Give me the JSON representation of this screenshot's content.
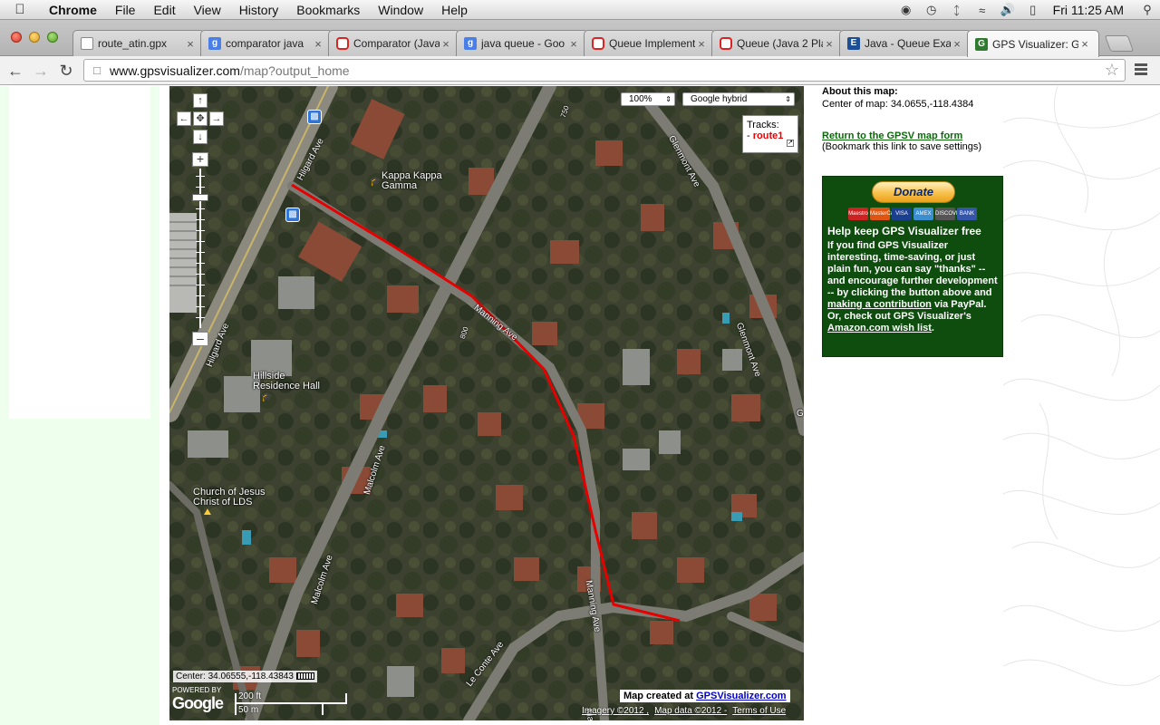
{
  "menubar": {
    "app_name": "Chrome",
    "items": [
      "File",
      "Edit",
      "View",
      "History",
      "Bookmarks",
      "Window",
      "Help"
    ],
    "clock": "Fri 11:25 AM",
    "status_icons": [
      "time-machine-icon",
      "history-clock-icon",
      "bluetooth-icon",
      "wifi-icon",
      "volume-icon",
      "battery-icon",
      "spotlight-search-icon"
    ]
  },
  "tabs": [
    {
      "title": "route_atin.gpx",
      "favicon": "doc"
    },
    {
      "title": "comparator java",
      "favicon": "google"
    },
    {
      "title": "Comparator (Java",
      "favicon": "oracle"
    },
    {
      "title": "java queue - Goo",
      "favicon": "google"
    },
    {
      "title": "Queue Implement",
      "favicon": "oracle"
    },
    {
      "title": "Queue (Java 2 Pla",
      "favicon": "oracle"
    },
    {
      "title": "Java - Queue Exa",
      "favicon": "blue"
    },
    {
      "title": "GPS Visualizer: G",
      "favicon": "gpsv",
      "active": true
    }
  ],
  "toolbar": {
    "url_host": "www.gpsvisualizer.com",
    "url_path": "/map?output_home"
  },
  "map": {
    "zoom_select": "100%",
    "maptype_select": "Google hybrid",
    "tracks_header": "Tracks:",
    "route_name": "route1",
    "route_prefix": "- ",
    "center_readout": "Center: 34.06555,-118.43843",
    "google_powered": "POWERED BY",
    "google_word": "Google",
    "scale_ft": "200 ft",
    "scale_m": "50 m",
    "map_created_prefix": "Map created at",
    "map_created_link": "GPSVisualizer.com",
    "attribution": [
      "Imagery ©2012 ,",
      "Map data ©2012 -",
      "Terms of Use"
    ],
    "labels": {
      "kappa": "Kappa Kappa\nGamma",
      "hillside": "Hillside\nResidence Hall",
      "church": "Church of Jesus\nChrist of LDS"
    },
    "streets": {
      "hilgard_top": "Hilgard Ave",
      "hilgard_left": "Hilgard Ave",
      "glenmont_top": "Glenmont Ave",
      "glenmont_right": "Glenmont Ave",
      "malcolm_mid": "Malcolm Ave",
      "malcolm_low": "Malcolm Ave",
      "manning_diag": "Manning Ave",
      "manning_low": "Manning Ave",
      "le_conte": "Le Conte Ave",
      "num_750": "750",
      "num_800": "800",
      "manning_bottom": "Man",
      "glenmont_edge": "G"
    },
    "route_color": "#e60000"
  },
  "info": {
    "about_title": "About this map:",
    "center_text": "Center of map: 34.0655,-118.4384",
    "return_link": "Return to the GPSV map form",
    "bookmark_note": "(Bookmark this link to save settings)"
  },
  "donate": {
    "button": "Donate",
    "cards": [
      "Maestro",
      "MasterCard",
      "VISA",
      "AMEX",
      "DISCOVER",
      "BANK"
    ],
    "heading": "Help keep GPS Visualizer free",
    "body_1": "If you find GPS Visualizer interesting, time-saving, or just plain fun, you can say \"thanks\" -- and encourage further development -- by clicking the button above and ",
    "link_1": "making a contribution",
    "body_2": " via PayPal. Or, check out GPS Visualizer's ",
    "link_2": "Amazon.com wish list",
    "body_3": "."
  }
}
